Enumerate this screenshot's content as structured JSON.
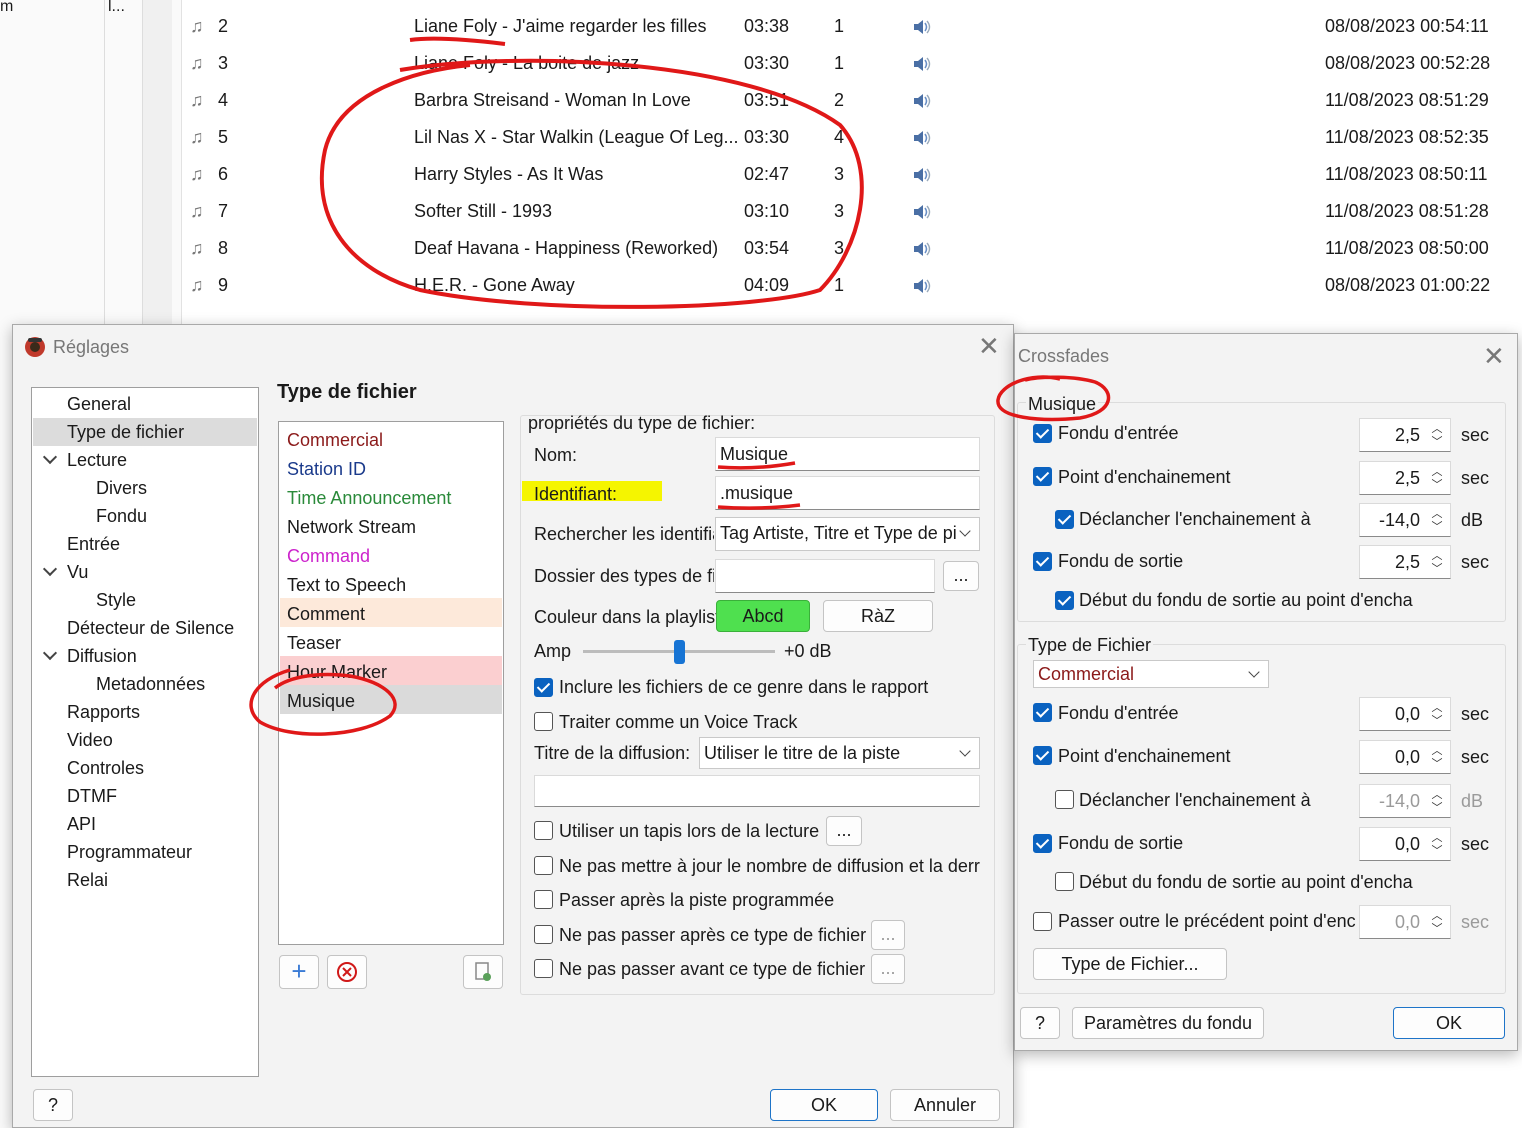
{
  "background": {
    "left_col_a": "m",
    "left_col_b": "l...",
    "playlist_rows": [
      {
        "num": "2",
        "title": "Liane Foly - J'aime regarder les filles",
        "duration": "03:38",
        "count": "1",
        "date": "08/08/2023 00:54:11"
      },
      {
        "num": "3",
        "title": "Liane Foly - La boite de jazz",
        "duration": "03:30",
        "count": "1",
        "date": "08/08/2023 00:52:28"
      },
      {
        "num": "4",
        "title": "Barbra Streisand - Woman In Love",
        "duration": "03:51",
        "count": "2",
        "date": "11/08/2023 08:51:29"
      },
      {
        "num": "5",
        "title": "Lil Nas X - Star Walkin  (League Of Leg...",
        "duration": "03:30",
        "count": "4",
        "date": "11/08/2023 08:52:35"
      },
      {
        "num": "6",
        "title": "Harry Styles - As It Was",
        "duration": "02:47",
        "count": "3",
        "date": "11/08/2023 08:50:11"
      },
      {
        "num": "7",
        "title": "Softer Still - 1993",
        "duration": "03:10",
        "count": "3",
        "date": "11/08/2023 08:51:28"
      },
      {
        "num": "8",
        "title": "Deaf Havana - Happiness (Reworked)",
        "duration": "03:54",
        "count": "3",
        "date": "11/08/2023 08:50:00"
      },
      {
        "num": "9",
        "title": "H.E.R. - Gone Away",
        "duration": "04:09",
        "count": "1",
        "date": "08/08/2023 01:00:22"
      }
    ]
  },
  "settings": {
    "title": "Réglages",
    "tree": {
      "general": "General",
      "file_type": "Type de fichier",
      "lecture": "Lecture",
      "divers": "Divers",
      "fondu": "Fondu",
      "entree": "Entrée",
      "vu": "Vu",
      "style": "Style",
      "silence": "Détecteur de Silence",
      "diffusion": "Diffusion",
      "metadonnees": "Metadonnées",
      "rapports": "Rapports",
      "video": "Video",
      "controles": "Controles",
      "dtmf": "DTMF",
      "api": "API",
      "programmateur": "Programmateur",
      "relai": "Relai"
    },
    "section_title": "Type de fichier",
    "file_types": [
      {
        "label": "Commercial",
        "color": "#8b1a1a",
        "bg": "#ffffff"
      },
      {
        "label": "Station ID",
        "color": "#1a3a8b",
        "bg": "#ffffff"
      },
      {
        "label": "Time Announcement",
        "color": "#2a8a3a",
        "bg": "#ffffff"
      },
      {
        "label": "Network Stream",
        "color": "#1a1a1a",
        "bg": "#ffffff"
      },
      {
        "label": "Command",
        "color": "#cc22cc",
        "bg": "#ffffff"
      },
      {
        "label": "Text to Speech",
        "color": "#1a1a1a",
        "bg": "#ffffff"
      },
      {
        "label": "Comment",
        "color": "#1a1a1a",
        "bg": "#fde9da"
      },
      {
        "label": "Teaser",
        "color": "#1a1a1a",
        "bg": "#ffffff"
      },
      {
        "label": "Hour Marker",
        "color": "#1a1a1a",
        "bg": "#fbcfd0"
      },
      {
        "label": "Musique",
        "color": "#1a1a1a",
        "bg": "#dadada"
      }
    ],
    "props_title": "propriétés du type de fichier:",
    "nom_label": "Nom:",
    "nom_value": "Musique",
    "id_label": "Identifiant:",
    "id_value": ".musique",
    "search_label": "Rechercher les identifiai",
    "search_value": "Tag Artiste, Titre et Type de pi",
    "folder_label": "Dossier des types de fi",
    "folder_value": "",
    "browse_label": "...",
    "color_label": "Couleur dans la playlist",
    "color_swatch_label": "Abcd",
    "color_swatch": "#4fe04f",
    "reset_label": "RàZ",
    "amp_label": "Amp",
    "amp_level": 0.5,
    "amp_value": "+0 dB",
    "include_report": "Inclure les fichiers de ce genre dans le rapport",
    "voice_track": "Traiter comme un Voice Track",
    "broadcast_title_label": "Titre de la diffusion:",
    "broadcast_title_value": "Utiliser le titre de la piste",
    "broadcast_extra_value": "",
    "bed_label": "Utiliser un tapis lors de la lecture",
    "bed_button": "...",
    "no_update_label": "Ne pas mettre à jour le nombre de diffusion et la derr",
    "pass_after_label": "Passer après la piste programmée",
    "not_after_label": "Ne pas passer après ce type de fichier",
    "not_after_button": "...",
    "not_before_label": "Ne pas passer avant ce type de fichier",
    "not_before_button": "...",
    "help_label": "?",
    "ok_label": "OK",
    "cancel_label": "Annuler"
  },
  "crossfades": {
    "title": "Crossfades",
    "group1_title": "Musique",
    "group1": {
      "fade_in_label": "Fondu d'entrée",
      "fade_in_value": "2,5",
      "fade_in_unit": "sec",
      "chain_label": "Point d'enchainement",
      "chain_value": "2,5",
      "chain_unit": "sec",
      "trigger_label": "Déclancher l'enchainement à",
      "trigger_value": "-14,0",
      "trigger_unit": "dB",
      "fade_out_label": "Fondu de sortie",
      "fade_out_value": "2,5",
      "fade_out_unit": "sec",
      "fade_out_start_label": "Début du fondu de sortie au point d'encha"
    },
    "group2_title": "Type de Fichier",
    "group2_combo": "Commercial",
    "group2": {
      "fade_in_label": "Fondu d'entrée",
      "fade_in_value": "0,0",
      "fade_in_unit": "sec",
      "chain_label": "Point d'enchainement",
      "chain_value": "0,0",
      "chain_unit": "sec",
      "trigger_label": "Déclancher l'enchainement à",
      "trigger_value": "-14,0",
      "trigger_unit": "dB",
      "fade_out_label": "Fondu de sortie",
      "fade_out_value": "0,0",
      "fade_out_unit": "sec",
      "fade_out_start_label": "Début du fondu de sortie au point d'encha",
      "skip_label": "Passer outre le précédent point d'encl",
      "skip_value": "0,0",
      "skip_unit": "sec"
    },
    "file_type_button": "Type de Fichier...",
    "help_label": "?",
    "params_label": "Paramètres du fondu",
    "ok_label": "OK"
  },
  "colors": {
    "annotation_red": "#e01818",
    "highlight_yellow": "#f5f500",
    "checkbox_blue": "#0a62c0",
    "primary_border": "#1e74c8"
  }
}
